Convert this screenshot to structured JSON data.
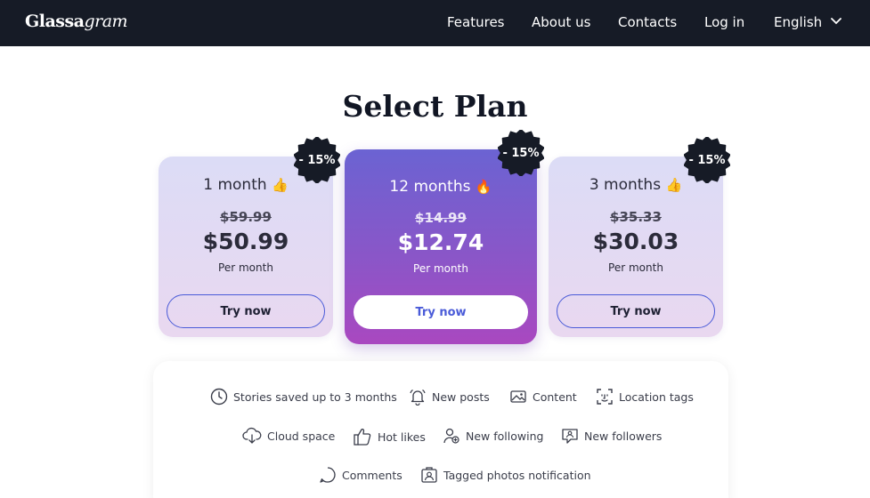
{
  "header": {
    "logo_bold": "Glassa",
    "logo_italic": "gram",
    "nav": [
      "Features",
      "About us",
      "Contacts",
      "Log in"
    ],
    "language": "English"
  },
  "page_title": "Select Plan",
  "plans": [
    {
      "title": "1 month",
      "emoji": "👍",
      "old_price": "$59.99",
      "price": "$50.99",
      "period": "Per month",
      "button": "Try now",
      "discount": "- 15%"
    },
    {
      "title": "12 months",
      "emoji": "🔥",
      "old_price": "$14.99",
      "price": "$12.74",
      "period": "Per month",
      "button": "Try now",
      "discount": "- 15%"
    },
    {
      "title": "3 months",
      "emoji": "👍",
      "old_price": "$35.33",
      "price": "$30.03",
      "period": "Per month",
      "button": "Try now",
      "discount": "- 15%"
    }
  ],
  "features": [
    {
      "label": "Stories saved up to 3 months",
      "icon": "clock-icon"
    },
    {
      "label": "New posts",
      "icon": "bell-icon"
    },
    {
      "label": "Content",
      "icon": "image-icon"
    },
    {
      "label": "Location tags",
      "icon": "face-scan-icon"
    },
    {
      "label": "Cloud space",
      "icon": "cloud-download-icon"
    },
    {
      "label": "Hot likes",
      "icon": "thumbs-up-icon"
    },
    {
      "label": "New following",
      "icon": "user-add-icon"
    },
    {
      "label": "New followers",
      "icon": "user-message-icon"
    },
    {
      "label": "Comments",
      "icon": "chat-bubble-icon"
    },
    {
      "label": "Tagged photos notification",
      "icon": "tagged-photo-icon"
    }
  ],
  "colors": {
    "header_bg": "#161b26",
    "accent_blue": "#4a5bd8",
    "featured_gradient_top": "#6b63d2",
    "featured_gradient_bottom": "#a948c0",
    "badge_bg": "#161b26"
  }
}
